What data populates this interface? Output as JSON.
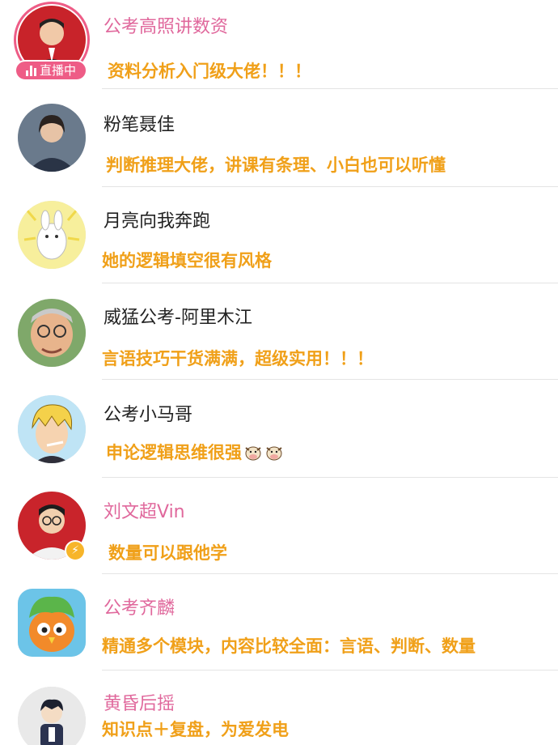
{
  "items": [
    {
      "name": "公考高照讲数资",
      "comment": "资料分析入门级大佬！！！",
      "name_color": "pink",
      "live": true,
      "live_label": "直播中",
      "avatar": "man-red-background-avatar"
    },
    {
      "name": "粉笔聂佳",
      "comment": "判断推理大佬，讲课有条理、小白也可以听懂",
      "name_color": "dark",
      "avatar": "woman-portrait-avatar"
    },
    {
      "name": "月亮向我奔跑",
      "comment": "她的逻辑填空很有风格",
      "name_color": "dark",
      "avatar": "cartoon-bunny-avatar"
    },
    {
      "name": "威猛公考-阿里木江",
      "comment": "言语技巧干货满满，超级实用！！！",
      "name_color": "dark",
      "avatar": "cartoon-old-man-avatar"
    },
    {
      "name": "公考小马哥",
      "comment": "申论逻辑思维很强",
      "name_color": "dark",
      "comment_emoji": [
        "cow-icon",
        "cow-icon"
      ],
      "avatar": "anime-blond-character-avatar"
    },
    {
      "name": "刘文超Vin",
      "comment": "数量可以跟他学",
      "name_color": "pink",
      "verified_badge": "lightning-icon",
      "avatar": "man-glasses-red-background-avatar"
    },
    {
      "name": "公考齐麟",
      "comment": "精通多个模块，内容比较全面：言语、判断、数量",
      "name_color": "pink",
      "avatar": "cartoon-green-creature-avatar"
    },
    {
      "name": "黄昏后摇",
      "comment": "知识点＋复盘，为爱发电",
      "name_color": "pink",
      "avatar": "anime-boy-avatar"
    }
  ],
  "colors": {
    "pink_name": "#e0689c",
    "comment_orange": "#f0a019",
    "live_badge": "#ee5c86",
    "divider": "#e4e4e4"
  }
}
